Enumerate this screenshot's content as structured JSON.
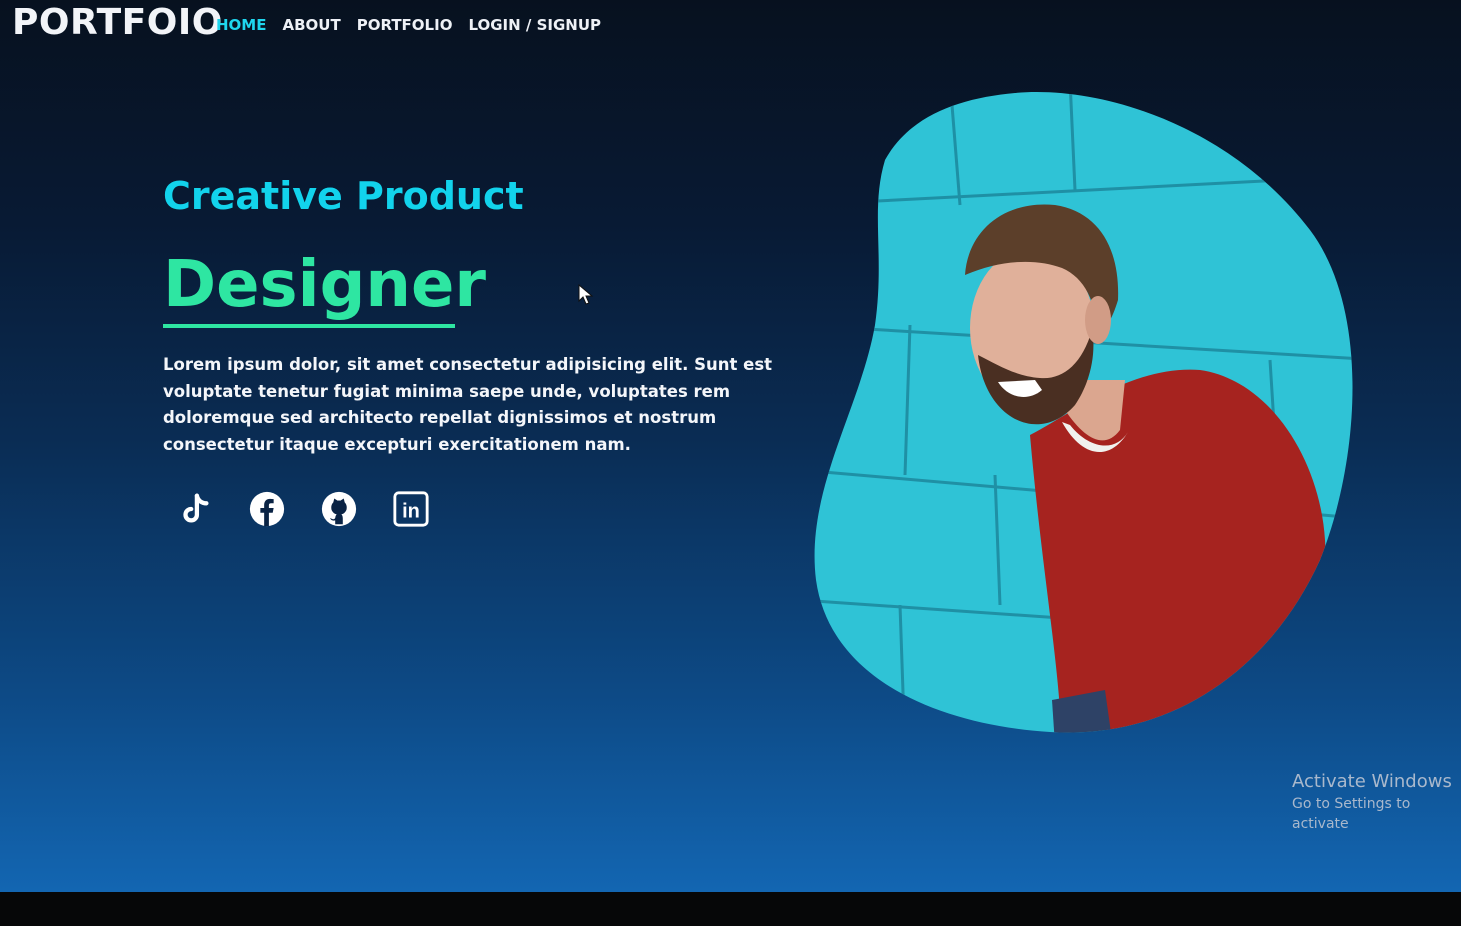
{
  "brand": {
    "logo": "PORTFOIO"
  },
  "nav": {
    "items": [
      {
        "label": "HOME",
        "active": true
      },
      {
        "label": "ABOUT",
        "active": false
      },
      {
        "label": "PORTFOLIO",
        "active": false
      },
      {
        "label": "LOGIN / SIGNUP",
        "active": false
      }
    ]
  },
  "hero": {
    "subtitle": "Creative Product",
    "title": "Designer",
    "description": "Lorem ipsum dolor, sit amet consectetur adipisicing elit. Sunt est voluptate tenetur fugiat minima saepe unde, voluptates rem doloremque sed architecto repellat dignissimos et nostrum consectetur itaque excepturi exercitationem nam."
  },
  "socials": [
    {
      "icon": "tiktok-icon"
    },
    {
      "icon": "facebook-icon"
    },
    {
      "icon": "github-icon"
    },
    {
      "icon": "linkedin-icon",
      "glyph": "in"
    }
  ],
  "watermark": {
    "title": "Activate Windows",
    "subtitle": "Go to Settings to activate"
  },
  "colors": {
    "accent_cyan": "#12d3ec",
    "accent_green": "#2ee6a2",
    "background_top": "#07111f",
    "background_bottom": "#1366b2",
    "photo_wall": "#2fc3d6",
    "sweater": "#a6231f"
  }
}
